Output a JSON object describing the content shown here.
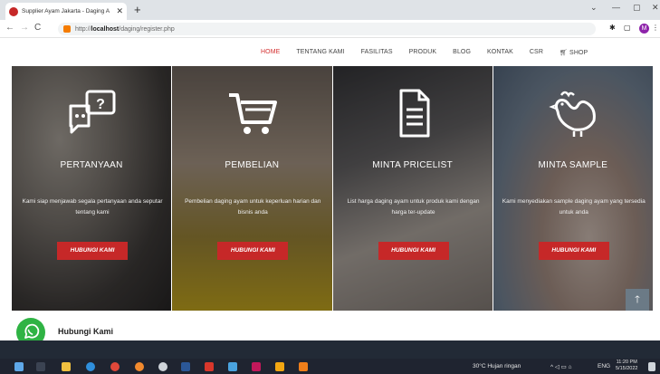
{
  "browser": {
    "tab_title": "Supplier Ayam Jakarta - Daging A",
    "tab_close": "✕",
    "new_tab": "+",
    "window_controls": [
      "⌄",
      "—",
      "▢",
      "✕"
    ],
    "url_prefix": "http://",
    "url_host": "localhost",
    "url_path": "/daging/register.php",
    "profile_initial": "M"
  },
  "nav": {
    "items": [
      {
        "label": "HOME",
        "active": true
      },
      {
        "label": "TENTANG KAMI"
      },
      {
        "label": "FASILITAS"
      },
      {
        "label": "PRODUK"
      },
      {
        "label": "BLOG"
      },
      {
        "label": "KONTAK"
      },
      {
        "label": "CSR"
      },
      {
        "label": "SHOP"
      }
    ],
    "shop_icon": "cart-icon"
  },
  "cards": [
    {
      "title": "PERTANYAAN",
      "desc": "Kami siap menjawab segala pertanyaan anda seputar tentang kami",
      "button": "HUBUNGI KAMI",
      "icon": "question-chat-icon"
    },
    {
      "title": "PEMBELIAN",
      "desc": "Pembelian daging ayam untuk keperluan harian dan bisnis anda",
      "button": "HUBUNGI KAMI",
      "icon": "shopping-cart-icon"
    },
    {
      "title": "MINTA PRICELIST",
      "desc": "List harga daging ayam untuk produk kami dengan harga ter-update",
      "button": "HUBUNGI KAMI",
      "icon": "document-icon"
    },
    {
      "title": "MINTA SAMPLE",
      "desc": "Kami menyediakan sample daging ayam yang tersedia untuk anda",
      "button": "HUBUNGI KAMI",
      "icon": "chicken-icon"
    }
  ],
  "contact": {
    "label": "Hubungi Kami",
    "icon": "whatsapp-icon"
  },
  "scroll_top": "🡑",
  "taskbar": {
    "weather": "30°C  Hujan ringan",
    "lang": "ENG",
    "time": "11:20 PM",
    "date": "5/15/2022"
  },
  "colors": {
    "accent": "#d32f2f",
    "button": "#c62828",
    "whatsapp": "#2fb344"
  }
}
